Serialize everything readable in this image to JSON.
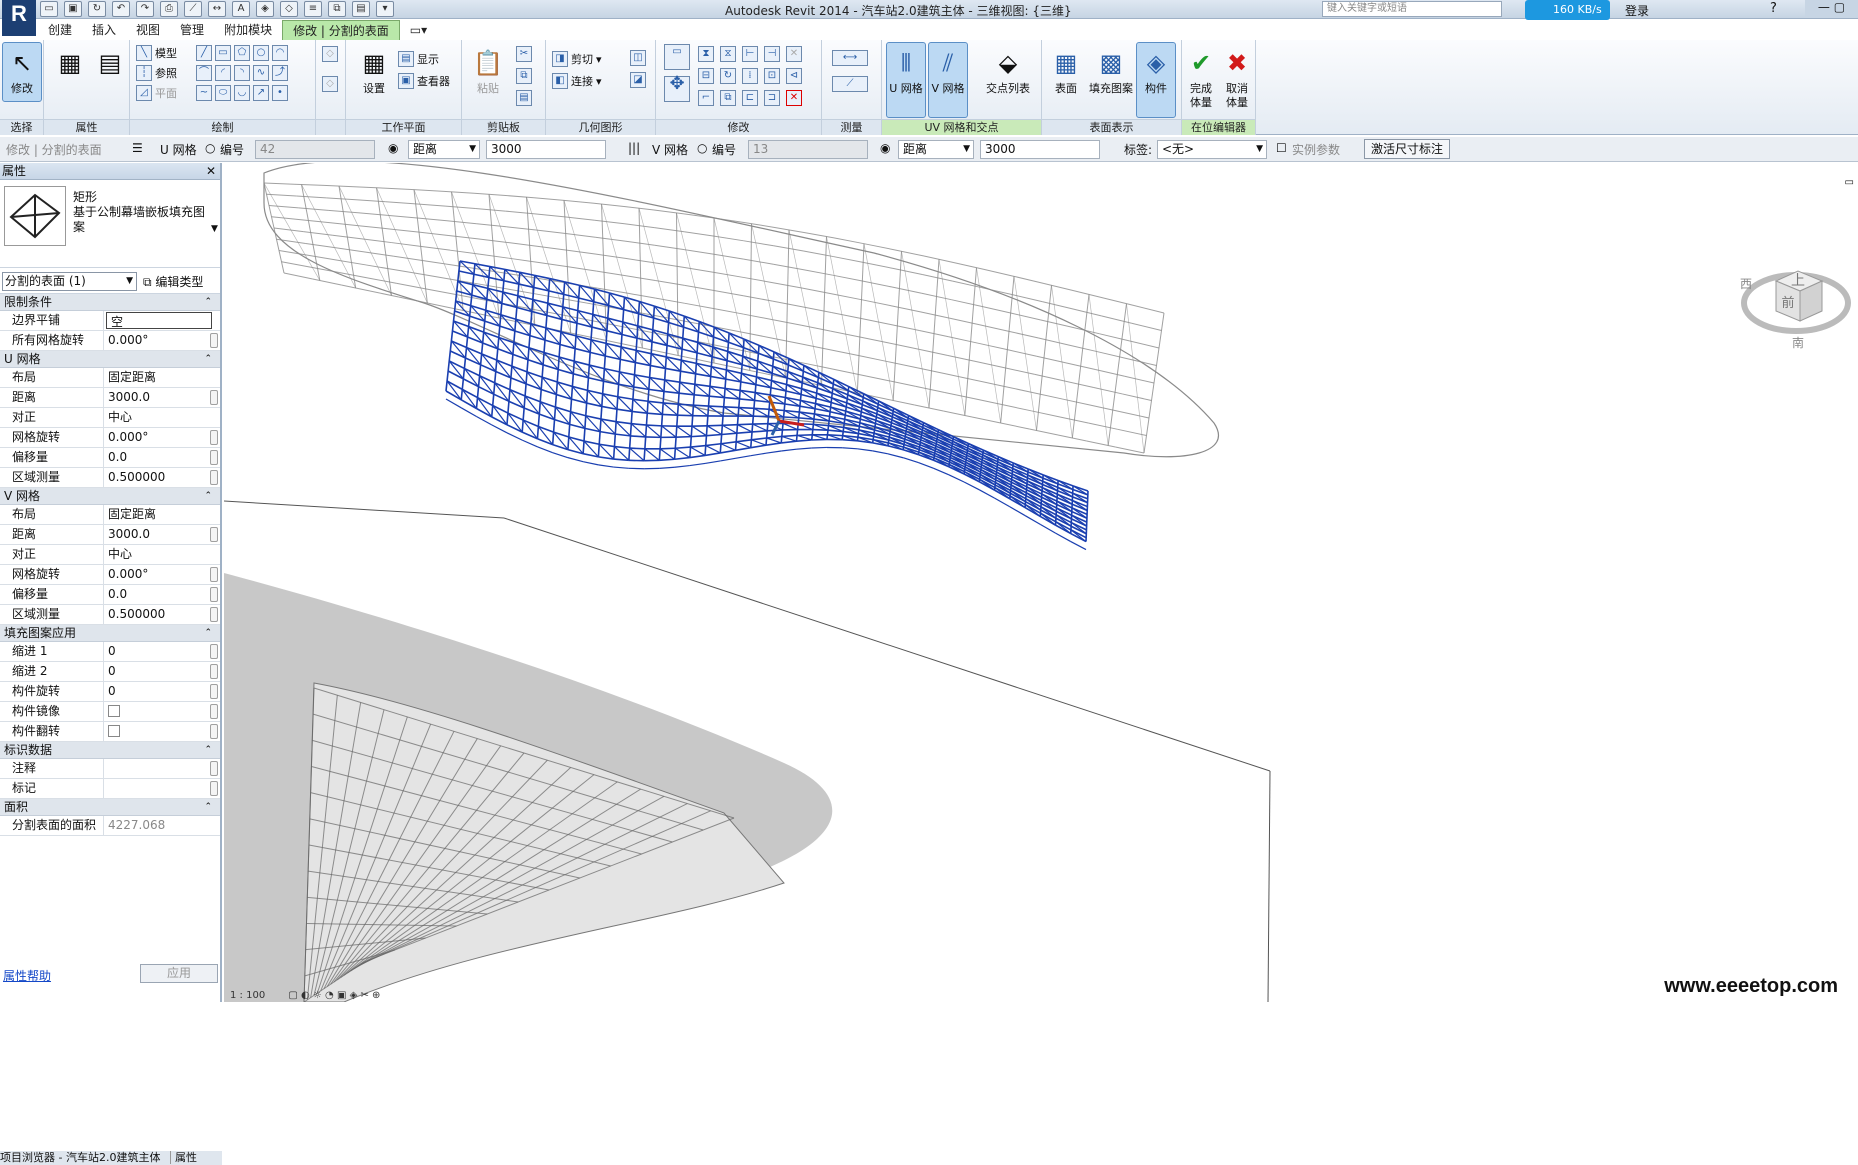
{
  "app": {
    "logo": "R",
    "title": "Autodesk Revit 2014 -    汽车站2.0建筑主体 - 三维视图: {三维}",
    "search_placeholder": "键入关键字或短语",
    "download_speed": "160 KB/s",
    "login": "登录"
  },
  "tabs": [
    "创建",
    "插入",
    "视图",
    "管理",
    "附加模块",
    "修改 | 分割的表面"
  ],
  "ribbon": {
    "select_panel": {
      "modify_label": "修改",
      "panel_label": "选择"
    },
    "properties_panel": {
      "panel_label": "属性"
    },
    "draw_panel": {
      "model": "模型",
      "reference": "参照",
      "plane": "平面",
      "panel_label": "绘制"
    },
    "workplane_panel": {
      "set": "设置",
      "show": "显示",
      "viewer": "查看器",
      "panel_label": "工作平面"
    },
    "clipboard_panel": {
      "paste": "粘贴",
      "panel_label": "剪贴板"
    },
    "geometry_panel": {
      "cut": "剪切",
      "join": "连接",
      "panel_label": "几何图形"
    },
    "modify_panel": {
      "panel_label": "修改"
    },
    "measure_panel": {
      "panel_label": "测量"
    },
    "uv_panel": {
      "u_grid": "U 网格",
      "v_grid": "V 网格",
      "intersects": "交点列表",
      "panel_label": "UV 网格和交点"
    },
    "surface_panel": {
      "surface": "表面",
      "pattern": "填充图案",
      "component": "构件",
      "panel_label": "表面表示"
    },
    "inplace_panel": {
      "finish": "完成\n体量",
      "cancel": "取消\n体量",
      "panel_label": "在位编辑器"
    }
  },
  "options_bar": {
    "context": "修改 | 分割的表面",
    "u_grid": "U 网格",
    "u_number_label": "编号",
    "u_number": "42",
    "u_mode": "距离",
    "u_distance": "3000",
    "v_grid": "V 网格",
    "v_number_label": "编号",
    "v_number": "13",
    "v_mode": "距离",
    "v_distance": "3000",
    "tag_label": "标签:",
    "tag_value": "<无>",
    "instance_param": "实例参数",
    "activate_dims": "激活尺寸标注"
  },
  "properties": {
    "title": "属性",
    "type_name": "矩形\n基于公制幕墙嵌板填充图案",
    "instance_selector": "分割的表面 (1)",
    "edit_type": "编辑类型",
    "groups": [
      {
        "name": "限制条件",
        "rows": [
          {
            "name": "边界平铺",
            "value": "空",
            "boxed": true
          },
          {
            "name": "所有网格旋转",
            "value": "0.000°",
            "sb": true
          }
        ]
      },
      {
        "name": "U 网格",
        "rows": [
          {
            "name": "布局",
            "value": "固定距离"
          },
          {
            "name": "距离",
            "value": "3000.0",
            "sb": true
          },
          {
            "name": "对正",
            "value": "中心"
          },
          {
            "name": "网格旋转",
            "value": "0.000°",
            "sb": true
          },
          {
            "name": "偏移量",
            "value": "0.0",
            "sb": true
          },
          {
            "name": "区域测量",
            "value": "0.500000",
            "sb": true
          }
        ]
      },
      {
        "name": "V 网格",
        "rows": [
          {
            "name": "布局",
            "value": "固定距离"
          },
          {
            "name": "距离",
            "value": "3000.0",
            "sb": true
          },
          {
            "name": "对正",
            "value": "中心"
          },
          {
            "name": "网格旋转",
            "value": "0.000°",
            "sb": true
          },
          {
            "name": "偏移量",
            "value": "0.0",
            "sb": true
          },
          {
            "name": "区域测量",
            "value": "0.500000",
            "sb": true
          }
        ]
      },
      {
        "name": "填充图案应用",
        "rows": [
          {
            "name": "缩进 1",
            "value": "0",
            "sb": true
          },
          {
            "name": "缩进 2",
            "value": "0",
            "sb": true
          },
          {
            "name": "构件旋转",
            "value": "0",
            "sb": true
          },
          {
            "name": "构件镜像",
            "value": "",
            "check": true,
            "sb": true
          },
          {
            "name": "构件翻转",
            "value": "",
            "check": true,
            "sb": true
          }
        ]
      },
      {
        "name": "标识数据",
        "rows": [
          {
            "name": "注释",
            "value": "",
            "sb": true
          },
          {
            "name": "标记",
            "value": "",
            "sb": true
          }
        ]
      },
      {
        "name": "面积",
        "rows": [
          {
            "name": "分割表面的面积",
            "value": "4227.068",
            "grey": true
          }
        ]
      }
    ],
    "help": "属性帮助",
    "apply": "应用",
    "browser_tab": "项目浏览器 - 汽车站2.0建筑主体",
    "props_tab": "属性"
  },
  "viewport": {
    "viewcube_top": "上",
    "viewcube_front": "前",
    "viewcube_west": "西",
    "viewcube_south": "南",
    "scale": "1 : 100",
    "watermark": "www.eeeetop.com",
    "grid_color": "#1a3fb0",
    "gray_color": "#8a8a8a"
  }
}
